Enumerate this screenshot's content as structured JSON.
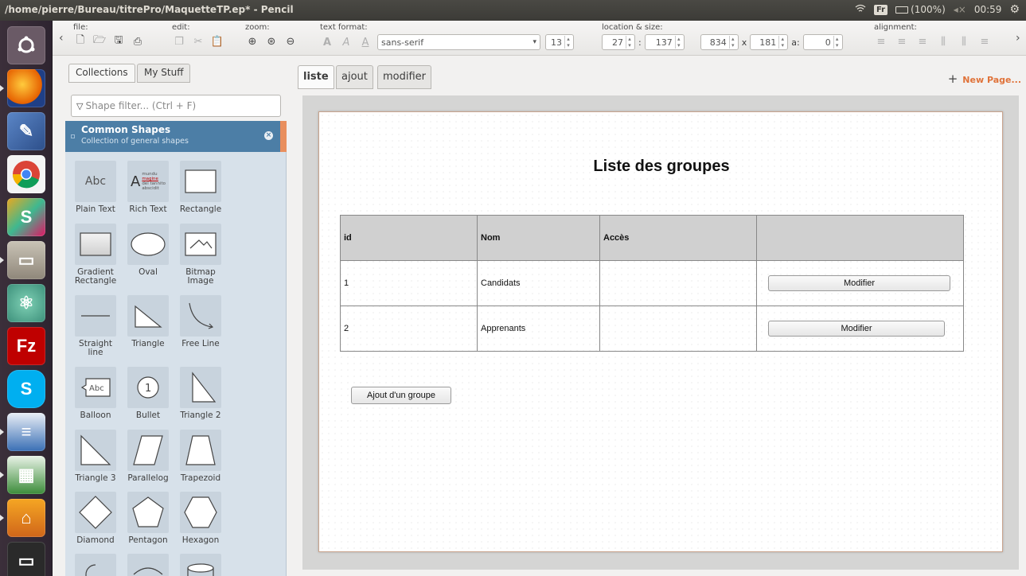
{
  "window": {
    "title": "/home/pierre/Bureau/titrePro/MaquetteTP.ep* - Pencil"
  },
  "tray": {
    "keyboard": "Fr",
    "battery": "(100%)",
    "time": "00:59"
  },
  "toolbar": {
    "file_label": "file:",
    "edit_label": "edit:",
    "zoom_label": "zoom:",
    "text_format_label": "text format:",
    "location_label": "location & size:",
    "alignment_label": "alignment:",
    "font_family": "sans-serif",
    "font_size": "13",
    "x": "27",
    "y": "137",
    "width": "834",
    "height": "181",
    "angle": "0",
    "sep_colon": ":",
    "sep_x": "x",
    "angle_label": "a:"
  },
  "panel": {
    "tab_collections": "Collections",
    "tab_mystuff": "My Stuff",
    "filter_placeholder": "Shape filter... (Ctrl + F)",
    "collection_title": "Common Shapes",
    "collection_subtitle": "Collection of general shapes",
    "shapes": [
      "Plain Text",
      "Rich Text",
      "Rectangle",
      "Gradient Rectangle",
      "Oval",
      "Bitmap Image",
      "Straight line",
      "Triangle",
      "Free Line",
      "Balloon",
      "Bullet",
      "Triangle 2",
      "Triangle 3",
      "Parallelog",
      "Trapezoid",
      "Diamond",
      "Pentagon",
      "Hexagon"
    ],
    "thumb_abc": "Abc",
    "thumb_rich_a": "A",
    "thumb_rich_lines": [
      "mundu",
      "magine",
      "del tannito",
      "abscidit"
    ],
    "thumb_bullet": "1"
  },
  "pages": {
    "tabs": [
      "liste",
      "ajout",
      "modifier"
    ],
    "new_page": "New Page..."
  },
  "mockup": {
    "title": "Liste des groupes",
    "headers": [
      "id",
      "Nom",
      "Accès",
      ""
    ],
    "rows": [
      {
        "id": "1",
        "nom": "Candidats",
        "acces": "",
        "button": "Modifier"
      },
      {
        "id": "2",
        "nom": "Apprenants",
        "acces": "",
        "button": "Modifier"
      }
    ],
    "add_button": "Ajout d'un groupe"
  },
  "colors": {
    "collection_header": "#4c7ea6",
    "new_page": "#e0733a",
    "topbar": "#3c3b37"
  }
}
